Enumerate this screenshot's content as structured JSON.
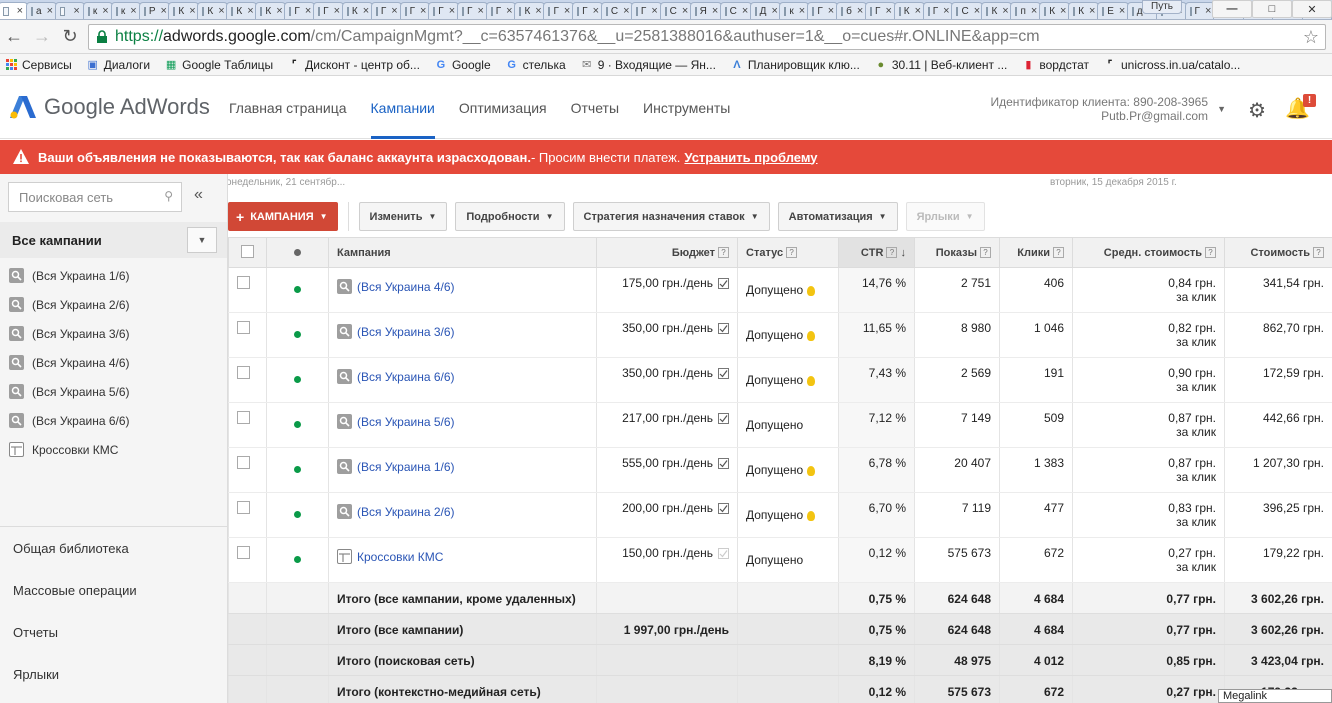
{
  "browser": {
    "tabs": [
      {
        "label": ""
      },
      {
        "label": "a"
      },
      {
        "label": ""
      },
      {
        "label": "к"
      },
      {
        "label": "к"
      },
      {
        "label": "Р"
      },
      {
        "label": "К"
      },
      {
        "label": "К"
      },
      {
        "label": "К"
      },
      {
        "label": "К"
      },
      {
        "label": "Г"
      },
      {
        "label": "Г"
      },
      {
        "label": "К"
      },
      {
        "label": "Г"
      },
      {
        "label": "Г"
      },
      {
        "label": "Г"
      },
      {
        "label": "Г"
      },
      {
        "label": "Г"
      },
      {
        "label": "К"
      },
      {
        "label": "Г"
      },
      {
        "label": "Г"
      },
      {
        "label": "С"
      },
      {
        "label": "Г"
      },
      {
        "label": "С"
      },
      {
        "label": "Я"
      },
      {
        "label": "С"
      },
      {
        "label": "Д"
      },
      {
        "label": "к"
      },
      {
        "label": "Г"
      },
      {
        "label": "б"
      },
      {
        "label": "Г"
      },
      {
        "label": "К"
      },
      {
        "label": "Г"
      },
      {
        "label": "С"
      },
      {
        "label": "К"
      },
      {
        "label": "п"
      },
      {
        "label": "К"
      },
      {
        "label": "К"
      },
      {
        "label": "Е"
      },
      {
        "label": "д"
      },
      {
        "label": "Г"
      },
      {
        "label": "Г"
      },
      {
        "label": "С"
      },
      {
        "label": "Г"
      },
      {
        "label": "Д"
      },
      {
        "label": "у"
      }
    ],
    "profile": "Путь",
    "url": {
      "protocol": "https://",
      "host": "adwords.google.com",
      "rest": "/cm/CampaignMgmt?__c=6357461376&__u=2581388016&authuser=1&__o=cues#r.ONLINE&app=cm"
    },
    "bookmarks": [
      {
        "label": "Сервисы",
        "icon": "apps-icon"
      },
      {
        "label": "Диалоги",
        "icon": "chat-icon"
      },
      {
        "label": "Google Таблицы",
        "icon": "sheets-icon"
      },
      {
        "label": "Дисконт - центр об...",
        "icon": "shoe-icon"
      },
      {
        "label": "Google",
        "icon": "google-icon"
      },
      {
        "label": "стелька",
        "icon": "google-icon"
      },
      {
        "label": "9 · Входящие — Ян...",
        "icon": "mail-icon"
      },
      {
        "label": "Планировщик клю...",
        "icon": "adwords-icon"
      },
      {
        "label": "30.11 | Веб-клиент ...",
        "icon": "android-icon"
      },
      {
        "label": "вордстат",
        "icon": "bar-chart-icon"
      },
      {
        "label": "unicross.in.ua/catalo...",
        "icon": "shoe-icon"
      }
    ]
  },
  "header": {
    "logo": "Google AdWords",
    "nav": [
      "Главная страница",
      "Кампании",
      "Оптимизация",
      "Отчеты",
      "Инструменты"
    ],
    "active_nav": "Кампании",
    "client_id": "Идентификатор клиента: 890-208-3965",
    "email": "Putb.Pr@gmail.com",
    "notification_badge": "!"
  },
  "alert": {
    "bold_text": "Ваши объявления не показываются, так как баланс аккаунта израсходован.",
    "text": " - Просим внести платеж.",
    "link": "Устранить проблему",
    "color": "#e5493a"
  },
  "sidebar": {
    "search_placeholder": "Поисковая сеть",
    "collapse": "«",
    "all_campaigns": "Все кампании",
    "campaigns": [
      {
        "label": "(Вся Украина 1/6)",
        "icon": "search-network-icon"
      },
      {
        "label": "(Вся Украина 2/6)",
        "icon": "search-network-icon"
      },
      {
        "label": "(Вся Украина 3/6)",
        "icon": "search-network-icon"
      },
      {
        "label": "(Вся Украина 4/6)",
        "icon": "search-network-icon"
      },
      {
        "label": "(Вся Украина 5/6)",
        "icon": "search-network-icon"
      },
      {
        "label": "(Вся Украина 6/6)",
        "icon": "search-network-icon"
      },
      {
        "label": "Кроссовки КМС",
        "icon": "display-network-icon"
      }
    ],
    "links": [
      "Общая библиотека",
      "Массовые операции",
      "Отчеты",
      "Ярлыки"
    ]
  },
  "main": {
    "date_left": "онедельник, 21 сентябр...",
    "date_right": "вторник, 15 декабря 2015 г.",
    "actions": {
      "campaign": "КАМПАНИЯ",
      "edit": "Изменить",
      "details": "Подробности",
      "bidding": "Стратегия назначения ставок",
      "automation": "Автоматизация",
      "labels": "Ярлыки"
    },
    "columns": {
      "campaign": "Кампания",
      "budget": "Бюджет",
      "status": "Статус",
      "ctr": "CTR",
      "impressions": "Показы",
      "clicks": "Клики",
      "avg_cpc": "Средн. стоимость",
      "cost": "Стоимость"
    },
    "help_mark": "?",
    "sort_arrow": "↓",
    "per_click": "за клик",
    "rows": [
      {
        "name": "(Вся Украина 4/6)",
        "type": "search",
        "budget": "175,00 грн./день",
        "status": "Допущено",
        "bulb": true,
        "ctr": "14,76 %",
        "impressions": "2 751",
        "clicks": "406",
        "cpc": "0,84 грн.",
        "cost": "341,54 грн."
      },
      {
        "name": "(Вся Украина 3/6)",
        "type": "search",
        "budget": "350,00 грн./день",
        "status": "Допущено",
        "bulb": true,
        "ctr": "11,65 %",
        "impressions": "8 980",
        "clicks": "1 046",
        "cpc": "0,82 грн.",
        "cost": "862,70 грн."
      },
      {
        "name": "(Вся Украина 6/6)",
        "type": "search",
        "budget": "350,00 грн./день",
        "status": "Допущено",
        "bulb": true,
        "ctr": "7,43 %",
        "impressions": "2 569",
        "clicks": "191",
        "cpc": "0,90 грн.",
        "cost": "172,59 грн."
      },
      {
        "name": "(Вся Украина 5/6)",
        "type": "search",
        "budget": "217,00 грн./день",
        "status": "Допущено",
        "bulb": false,
        "ctr": "7,12 %",
        "impressions": "7 149",
        "clicks": "509",
        "cpc": "0,87 грн.",
        "cost": "442,66 грн."
      },
      {
        "name": "(Вся Украина 1/6)",
        "type": "search",
        "budget": "555,00 грн./день",
        "status": "Допущено",
        "bulb": true,
        "ctr": "6,78 %",
        "impressions": "20 407",
        "clicks": "1 383",
        "cpc": "0,87 грн.",
        "cost": "1 207,30 грн."
      },
      {
        "name": "(Вся Украина 2/6)",
        "type": "search",
        "budget": "200,00 грн./день",
        "status": "Допущено",
        "bulb": true,
        "ctr": "6,70 %",
        "impressions": "7 119",
        "clicks": "477",
        "cpc": "0,83 грн.",
        "cost": "396,25 грн."
      },
      {
        "name": "Кроссовки КМС",
        "type": "display",
        "budget": "150,00 грн./день",
        "status": "Допущено",
        "bulb": false,
        "ctr": "0,12 %",
        "impressions": "575 673",
        "clicks": "672",
        "cpc": "0,27 грн.",
        "cost": "179,22 грн."
      }
    ],
    "totals": [
      {
        "label": "Итого (все кампании, кроме удаленных)",
        "budget": "",
        "ctr": "0,75 %",
        "impressions": "624 648",
        "clicks": "4 684",
        "cpc": "0,77 грн.",
        "cost": "3 602,26 грн."
      },
      {
        "label": "Итого (все кампании)",
        "budget": "1 997,00 грн./день",
        "ctr": "0,75 %",
        "impressions": "624 648",
        "clicks": "4 684",
        "cpc": "0,77 грн.",
        "cost": "3 602,26 грн."
      },
      {
        "label": "Итого (поисковая сеть)",
        "budget": "",
        "ctr": "8,19 %",
        "impressions": "48 975",
        "clicks": "4 012",
        "cpc": "0,85 грн.",
        "cost": "3 423,04 грн."
      },
      {
        "label": "Итого (контекстно-медийная сеть)",
        "budget": "",
        "ctr": "0,12 %",
        "impressions": "575 673",
        "clicks": "672",
        "cpc": "0,27 грн.",
        "cost": "179,22 грн."
      }
    ]
  },
  "tooltip": "Megalink"
}
